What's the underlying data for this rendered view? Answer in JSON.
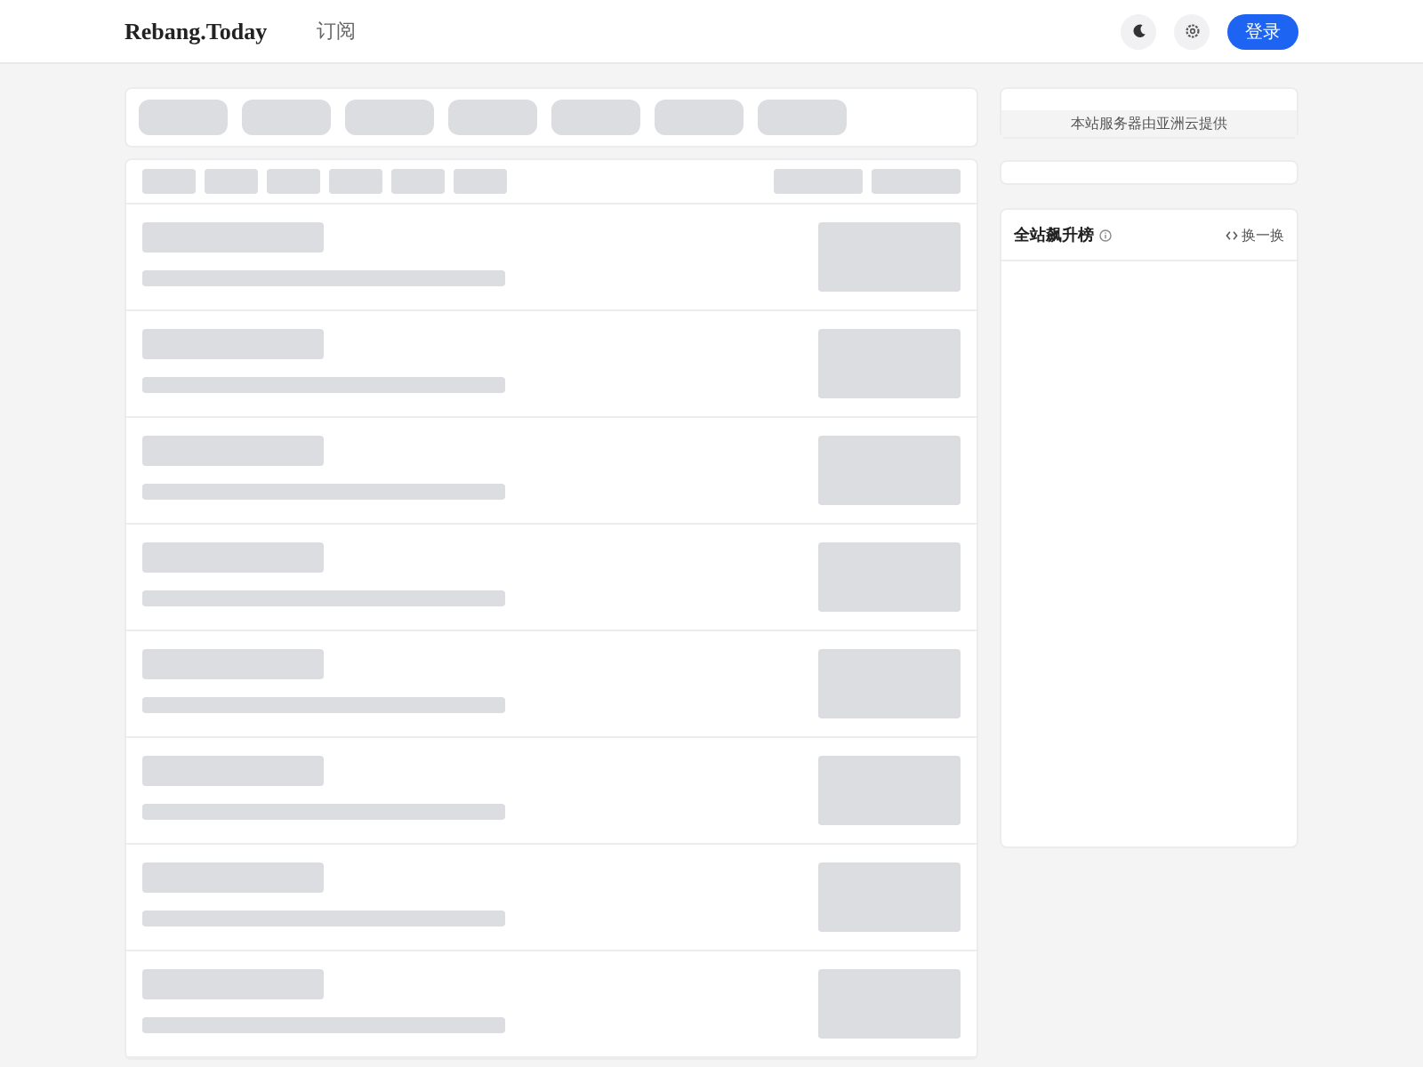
{
  "header": {
    "brand": "Rebang.Today",
    "nav": [
      {
        "label": "订阅"
      }
    ],
    "login_button": "登录"
  },
  "sidebar": {
    "sponsor_text": "本站服务器由亚洲云提供",
    "ranking": {
      "title": "全站飙升榜",
      "refresh_label": "换一换"
    }
  }
}
